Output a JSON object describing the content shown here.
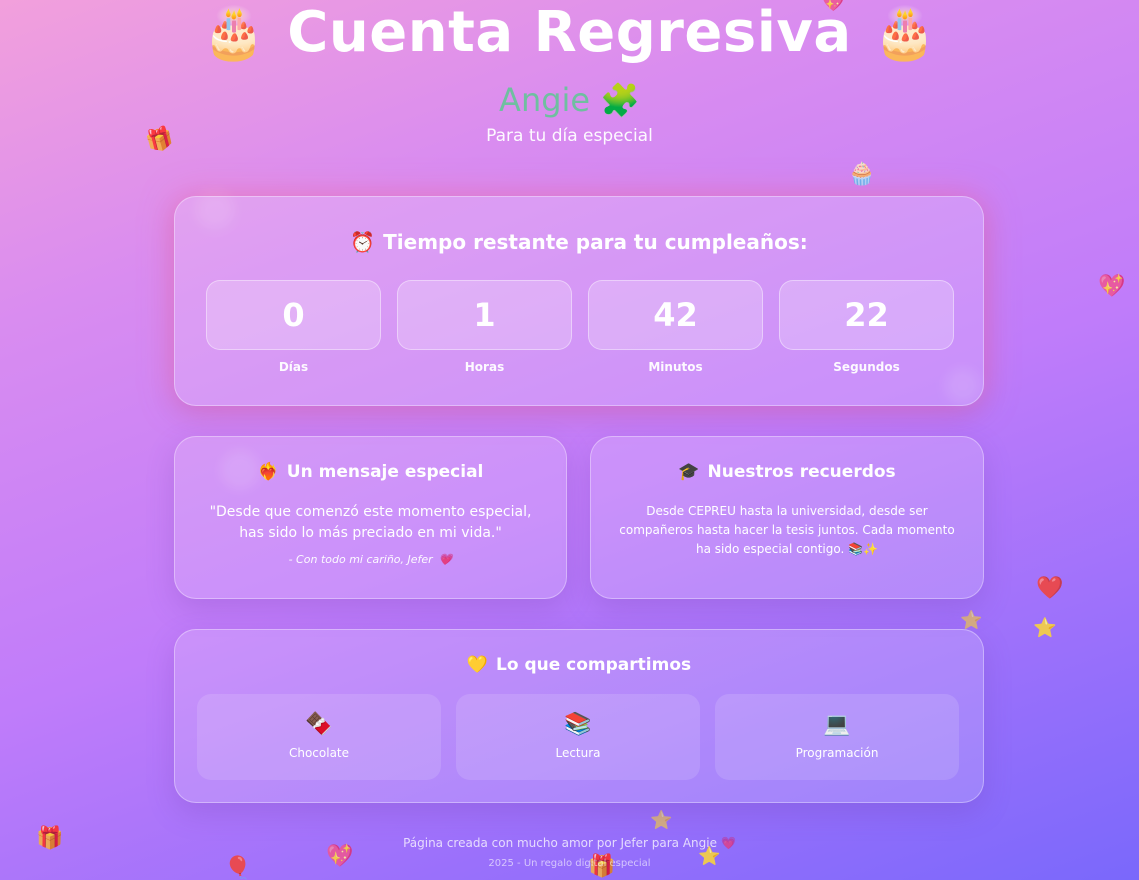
{
  "header": {
    "title": "Cuenta Regresiva",
    "cake_icon": "🎂",
    "name": "Angie",
    "name_icon": "🧩",
    "subtitle": "Para tu día especial"
  },
  "countdown": {
    "icon": "⏰",
    "heading": "Tiempo restante para tu cumpleaños:",
    "units": [
      {
        "value": "0",
        "label": "Días"
      },
      {
        "value": "1",
        "label": "Horas"
      },
      {
        "value": "42",
        "label": "Minutos"
      },
      {
        "value": "22",
        "label": "Segundos"
      }
    ]
  },
  "message": {
    "icon": "❤️‍🔥",
    "heading": "Un mensaje especial",
    "quote": "\"Desde que comenzó este momento especial, has sido lo más preciado en mi vida.\"",
    "signature": "- Con todo mi cariño, Jefer",
    "signature_icon": "💗"
  },
  "memories": {
    "icon": "🎓",
    "heading": "Nuestros recuerdos",
    "text": "Desde CEPREU hasta la universidad, desde ser compañeros hasta hacer la tesis juntos. Cada momento ha sido especial contigo. 📚✨"
  },
  "shared": {
    "icon": "💛",
    "heading": "Lo que compartimos",
    "items": [
      {
        "icon": "🍫",
        "label": "Chocolate"
      },
      {
        "icon": "📚",
        "label": "Lectura"
      },
      {
        "icon": "💻",
        "label": "Programación"
      }
    ]
  },
  "footer": {
    "line1": "Página creada con mucho amor por Jefer para Angie",
    "line1_icon": "💗",
    "line2": "2025 - Un regalo digital especial"
  },
  "floaters": {
    "gift": "🎁",
    "cupcake": "🧁",
    "heart_sparkle": "💖",
    "heart": "❤️",
    "star": "⭐",
    "balloon": "🎈"
  },
  "colors": {
    "name_accent": "#6fbfa0",
    "background_start": "#f2a0dc",
    "background_end": "#7a68fb"
  }
}
